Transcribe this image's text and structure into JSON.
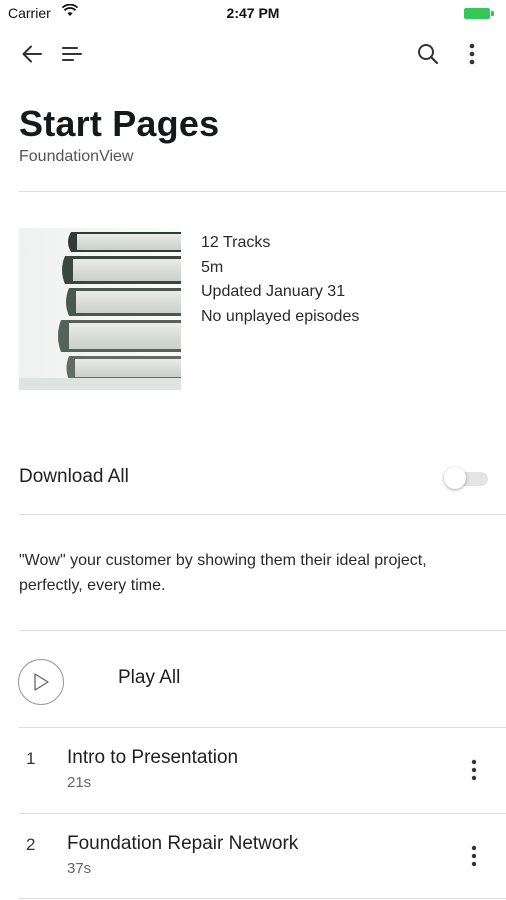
{
  "status_bar": {
    "carrier": "Carrier",
    "time": "2:47 PM",
    "wifi_icon": "wifi-icon",
    "battery_icon": "battery-icon"
  },
  "toolbar": {
    "back_icon": "back-arrow-icon",
    "menu_icon": "menu-icon",
    "search_icon": "search-icon",
    "more_icon": "more-vertical-icon"
  },
  "header": {
    "title": "Start Pages",
    "subtitle": "FoundationView"
  },
  "details": {
    "tracks": "12 Tracks",
    "duration": "5m",
    "updated": "Updated January 31",
    "unplayed": "No unplayed episodes"
  },
  "download": {
    "label": "Download All",
    "enabled": false
  },
  "description": "\"Wow\" your customer by showing them their ideal project, perfectly, every time.",
  "play_all": {
    "label": "Play All"
  },
  "tracks": [
    {
      "number": "1",
      "title": "Intro to Presentation",
      "duration": "21s"
    },
    {
      "number": "2",
      "title": "Foundation Repair Network",
      "duration": "37s"
    }
  ],
  "colors": {
    "battery": "#35c759",
    "text": "#1b1b1b",
    "divider": "#dcdcdc"
  }
}
